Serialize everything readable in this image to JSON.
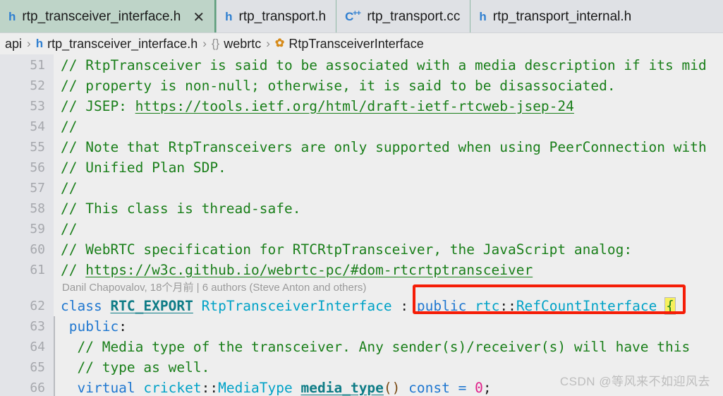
{
  "window": {
    "accent_active_tab": "#bed4c8",
    "accent_annotation": "#f51d07",
    "background": "#eeeeee"
  },
  "tabs": [
    {
      "icon": "h-header-file-icon",
      "icon_glyph": "h",
      "label": "rtp_transceiver_interface.h",
      "active": true,
      "close_glyph": "✕"
    },
    {
      "icon": "h-header-file-icon",
      "icon_glyph": "h",
      "label": "rtp_transport.h",
      "active": false
    },
    {
      "icon": "cpp-source-file-icon",
      "icon_glyph": "C",
      "icon_glyph_sup": "++",
      "label": "rtp_transport.cc",
      "active": false
    },
    {
      "icon": "h-header-file-icon",
      "icon_glyph": "h",
      "label": "rtp_transport_internal.h",
      "active": false
    }
  ],
  "breadcrumb": [
    {
      "icon": "",
      "icon_glyph": "",
      "label": "api"
    },
    {
      "icon": "h-header-file-icon",
      "icon_glyph": "h",
      "label": "rtp_transceiver_interface.h"
    },
    {
      "icon": "namespace-icon",
      "icon_glyph": "{}",
      "label": "webrtc"
    },
    {
      "icon": "class-icon",
      "icon_glyph": "✿",
      "label": "RtpTransceiverInterface"
    }
  ],
  "breadcrumb_separator": "›",
  "editor": {
    "blame": "Danil Chapovalov, 18个月前 | 6 authors (Steve Anton and others)",
    "lines": [
      {
        "num": "51",
        "text": "// RtpTransceiver is said to be associated with a media description if its mid"
      },
      {
        "num": "52",
        "text": "// property is non-null; otherwise, it is said to be disassociated."
      },
      {
        "num": "53",
        "text": "// JSEP: https://tools.ietf.org/html/draft-ietf-rtcweb-jsep-24"
      },
      {
        "num": "54",
        "text": "//"
      },
      {
        "num": "55",
        "text": "// Note that RtpTransceivers are only supported when using PeerConnection with"
      },
      {
        "num": "56",
        "text": "// Unified Plan SDP."
      },
      {
        "num": "57",
        "text": "//"
      },
      {
        "num": "58",
        "text": "// This class is thread-safe."
      },
      {
        "num": "59",
        "text": "//"
      },
      {
        "num": "60",
        "text": "// WebRTC specification for RTCRtpTransceiver, the JavaScript analog:"
      },
      {
        "num": "61",
        "text": "// https://w3c.github.io/webrtc-pc/#dom-rtcrtptransceiver"
      },
      {
        "num": "62",
        "text": "class RTC_EXPORT RtpTransceiverInterface : public rtc::RefCountInterface {"
      },
      {
        "num": "63",
        "text": " public:"
      },
      {
        "num": "64",
        "text": "  // Media type of the transceiver. Any sender(s)/receiver(s) will have this"
      },
      {
        "num": "65",
        "text": "  // type as well."
      },
      {
        "num": "66",
        "text": "  virtual cricket::MediaType media_type() const = 0;"
      }
    ],
    "tokens": {
      "l53_prefix": "// JSEP: ",
      "l53_url": "https://tools.ietf.org/html/draft-ietf-rtcweb-jsep-24",
      "l61_prefix": "// ",
      "l61_url": "https://w3c.github.io/webrtc-pc/#dom-rtcrtptransceiver",
      "l62_kw_class": "class",
      "l62_macro": "RTC_EXPORT",
      "l62_classname": "RtpTransceiverInterface",
      "l62_colon": ":",
      "l62_kw_public": "public",
      "l62_base_ns": "rtc",
      "l62_scope": "::",
      "l62_base": "RefCountInterface",
      "l62_brace": "{",
      "l63_kw_public": "public",
      "l63_colon": ":",
      "l66_kw_virtual": "virtual",
      "l66_ns": "cricket",
      "l66_scope": "::",
      "l66_type": "MediaType",
      "l66_method": "media_type",
      "l66_parens": "()",
      "l66_kw_const": "const",
      "l66_eq": "=",
      "l66_zero": "0",
      "l66_semi": ";"
    }
  },
  "annotation": {
    "label": "highlight-box-base-class",
    "color": "#f51d07"
  },
  "watermark": "CSDN @等风来不如迎风去"
}
